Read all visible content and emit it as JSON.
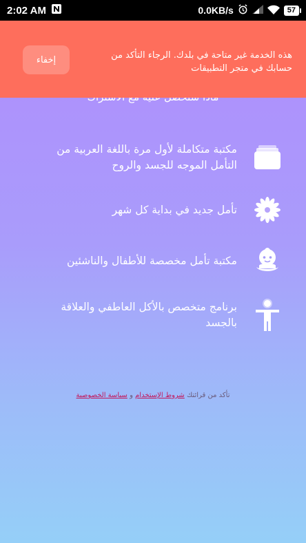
{
  "status_bar": {
    "time": "2:02 AM",
    "network_speed": "0.0KB/s",
    "battery": "57"
  },
  "banner": {
    "message": "هذه الخدمة غير متاحة في بلدك. الرجاء التأكد من حسابك في متجر التطبيقات",
    "hide_label": "إخفاء",
    "color": "#fe6e5c"
  },
  "partially_hidden_title": "ماذا ستحصل عليه مع الاشتراك",
  "features": [
    {
      "icon": "library-icon",
      "text": "مكتبة متكاملة لأول مرة باللغة العربية من التأمل الموجه للجسد والروح"
    },
    {
      "icon": "flower-icon",
      "text": "تأمل جديد في بداية كل شهر"
    },
    {
      "icon": "baby-icon",
      "text": "مكتبة تأمل مخصصة للأطفال والناشئين"
    },
    {
      "icon": "body-icon",
      "text": "برنامج متخصص بالأكل العاطفي والعلاقة بالجسد"
    }
  ],
  "terms": {
    "prefix": "تأكد من قرائتك",
    "terms_link": "شروط الإستخدام",
    "conjunction": "و",
    "privacy_link": "سياسة الخصوصية"
  }
}
